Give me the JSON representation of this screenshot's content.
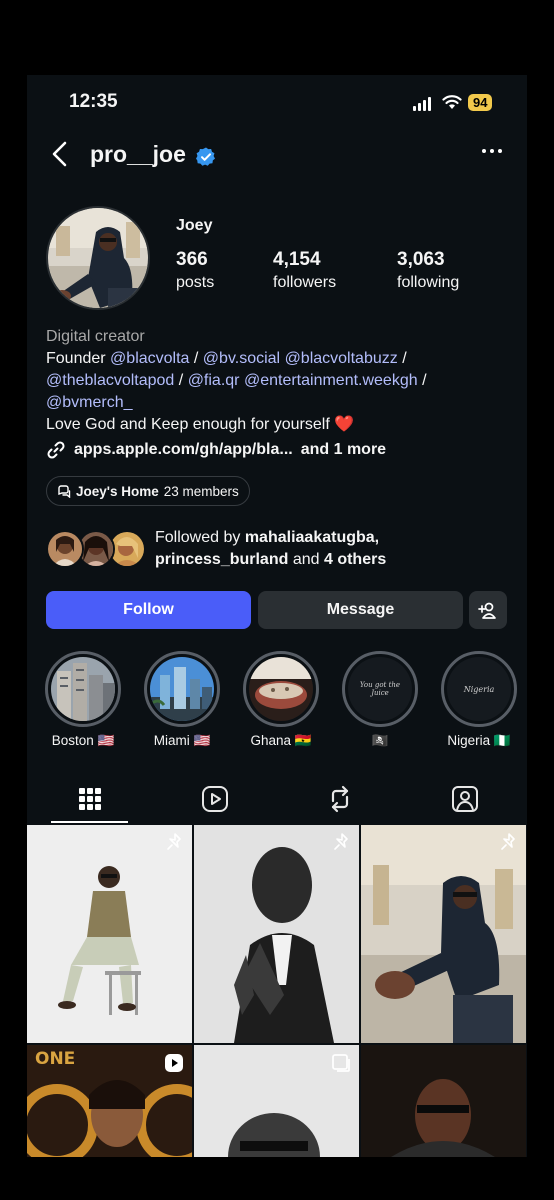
{
  "status_bar": {
    "time": "12:35",
    "battery": "94"
  },
  "header": {
    "username": "pro__joe"
  },
  "profile": {
    "display_name": "Joey",
    "stats": [
      {
        "value": "366",
        "label": "posts"
      },
      {
        "value": "4,154",
        "label": "followers"
      },
      {
        "value": "3,063",
        "label": "following"
      }
    ],
    "category": "Digital creator",
    "bio": {
      "founder_prefix": "Founder",
      "mentions": [
        "@blacvolta",
        "@bv.social",
        "@blacvoltabuzz",
        "@theblacvoltapod",
        "@fia.qr",
        "@entertainment.weekgh",
        "@bvmerch_"
      ],
      "separator": "/",
      "tagline": "Love God and Keep enough for yourself",
      "heart": "❤️"
    },
    "link": {
      "url": "apps.apple.com/gh/app/bla...",
      "more": "and 1 more"
    },
    "channel": {
      "name": "Joey's Home",
      "members": "23 members"
    },
    "followed_by": {
      "prefix": "Followed by",
      "user1": "mahaliaakatugba,",
      "user2": "princess_burland",
      "and_text": "and",
      "others": "4 others"
    }
  },
  "buttons": {
    "follow": "Follow",
    "message": "Message"
  },
  "highlights": [
    {
      "label": "Boston 🇺🇸",
      "inner_text": ""
    },
    {
      "label": "Miami 🇺🇸",
      "inner_text": ""
    },
    {
      "label": "Ghana 🇬🇭",
      "inner_text": ""
    },
    {
      "label": "🏴‍☠️",
      "inner_text": "You got the Juice"
    },
    {
      "label": "Nigeria 🇳🇬",
      "inner_text": "Nigeria"
    }
  ],
  "tabs": [
    {
      "icon": "grid-icon"
    },
    {
      "icon": "reels-icon"
    },
    {
      "icon": "reposts-icon"
    },
    {
      "icon": "tagged-icon"
    }
  ],
  "grid": {
    "post4_brand": "ONE"
  },
  "colors": {
    "background": "#0b1014",
    "accent": "#4a5df9",
    "mention": "#b3bdfb",
    "verified": "#3797f0",
    "battery": "#f2c94c"
  }
}
